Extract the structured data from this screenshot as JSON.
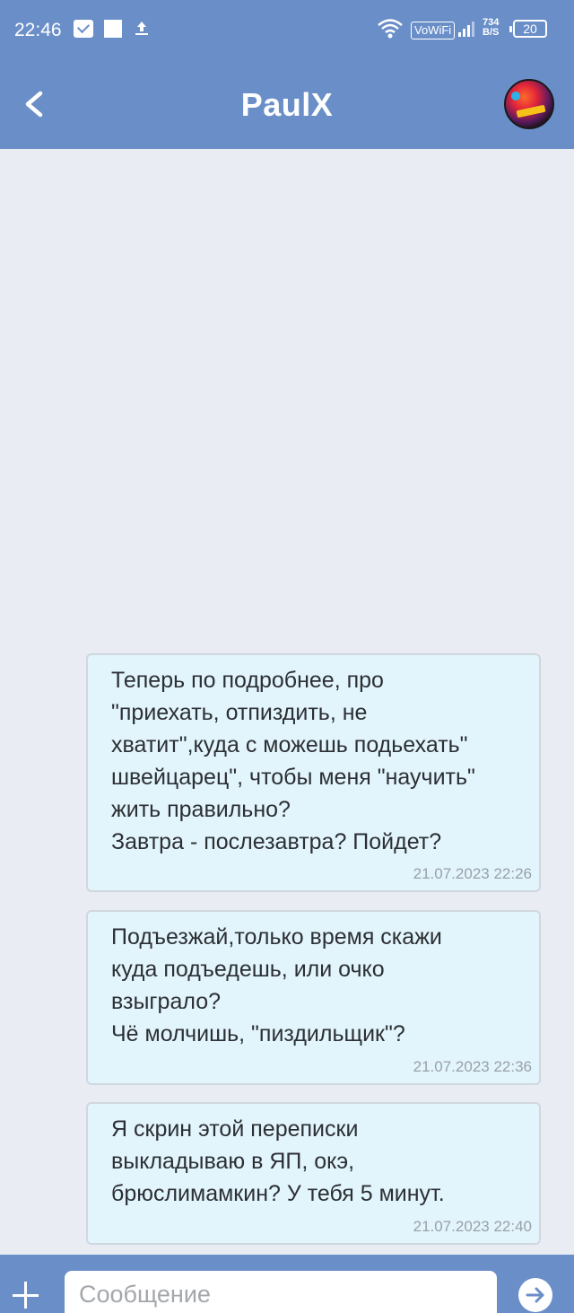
{
  "status_bar": {
    "time": "22:46",
    "network_label": "VoWiFi",
    "speed_value": "734",
    "speed_unit": "B/S",
    "battery": "20"
  },
  "header": {
    "title": "PaulX"
  },
  "messages": [
    {
      "text": "Теперь по подробнее, про\n\"приехать, отпиздить, не\nхватит\",куда с можешь подьехать\"\nшвейцарец\", чтобы меня \"научить\"\nжить правильно?\nЗавтра - послезавтра? Пойдет?",
      "time": "21.07.2023 22:26"
    },
    {
      "text": "Подъезжай,только время скажи\nкуда подъедешь, или очко\nвзыграло?\nЧё молчишь, \"пиздильщик\"?",
      "time": "21.07.2023 22:36"
    },
    {
      "text": "Я скрин этой переписки\nвыкладываю в ЯП, окэ,\nбрюслимамкин? У тебя 5 минут.",
      "time": "21.07.2023 22:40"
    }
  ],
  "composer": {
    "placeholder": "Сообщение"
  },
  "icons": {
    "back": "chevron-left-icon",
    "attach": "plus-icon",
    "send": "arrow-right-icon"
  },
  "colors": {
    "header_bg": "#6a8fc8",
    "page_bg": "#e9ecf3",
    "bubble_bg": "#e2f5fd",
    "bubble_border": "#d1d7de"
  }
}
